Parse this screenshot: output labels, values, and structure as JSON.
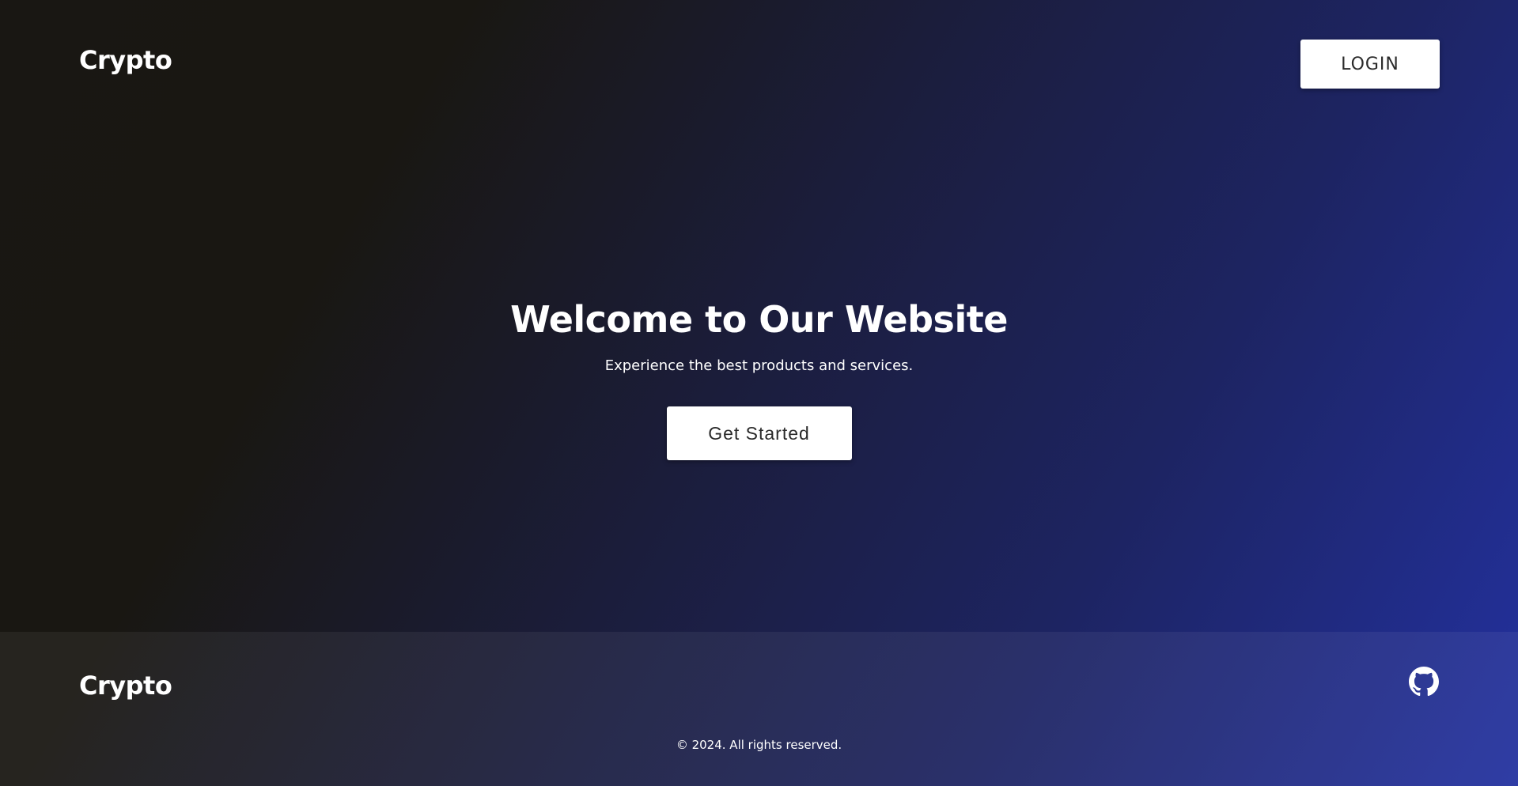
{
  "header": {
    "brand": "Crypto",
    "login_label": "LOGIN"
  },
  "hero": {
    "title": "Welcome to Our Website",
    "subtitle": "Experience the best products and services.",
    "cta_label": "Get Started"
  },
  "footer": {
    "brand": "Crypto",
    "social_icon": "github-icon",
    "copyright": "© 2024. All rights reserved."
  },
  "colors": {
    "gradient_start": "#191713",
    "gradient_end": "#2331a0",
    "button_background": "#ffffff",
    "button_text": "#2a2a2a",
    "text": "#ffffff"
  }
}
